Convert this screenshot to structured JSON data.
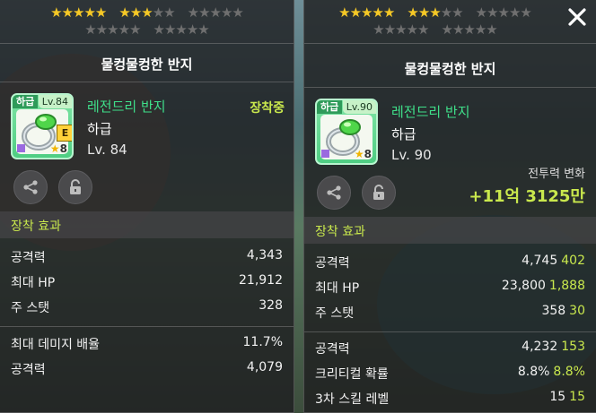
{
  "left_panel": {
    "stars_row1": {
      "filled_group1": 5,
      "total_group1": 5,
      "filled_group2": 3,
      "total_group2": 5,
      "filled_group3": 0,
      "total_group3": 5
    },
    "stars_row2": {
      "total_group1": 5,
      "total_group2": 5
    },
    "title": "물컹물컹한 반지",
    "item": {
      "grade_badge": "하급",
      "level_badge": "Lv.84",
      "name": "레전드리 반지",
      "grade": "하급",
      "level": "Lv. 84",
      "star_count": "8",
      "e_badge": "E"
    },
    "equipped_label": "장착중",
    "section_label": "장착 효과",
    "stats": [
      {
        "label": "공격력",
        "value": "4,343"
      },
      {
        "label": "최대 HP",
        "value": "21,912"
      },
      {
        "label": "주 스탯",
        "value": "328"
      }
    ],
    "stats2": [
      {
        "label": "최대 데미지 배율",
        "value": "11.7%"
      },
      {
        "label": "공격력",
        "value": "4,079"
      }
    ]
  },
  "right_panel": {
    "title": "물컹물컹한 반지",
    "item": {
      "grade_badge": "하급",
      "level_badge": "Lv.90",
      "name": "레전드리 반지",
      "grade": "하급",
      "level": "Lv. 90",
      "star_count": "8"
    },
    "battle_power_label": "전투력 변화",
    "battle_power_value": "+11억 3125만",
    "section_label": "장착 효과",
    "stats": [
      {
        "label": "공격력",
        "value": "4,745",
        "bonus": "402"
      },
      {
        "label": "최대 HP",
        "value": "23,800",
        "bonus": "1,888"
      },
      {
        "label": "주 스탯",
        "value": "358",
        "bonus": "30"
      }
    ],
    "stats2": [
      {
        "label": "공격력",
        "value": "4,232",
        "bonus": "153"
      },
      {
        "label": "크리티컬 확률",
        "value": "8.8%",
        "bonus": "8.8%"
      },
      {
        "label": "3차 스킬 레벨",
        "value": "15",
        "bonus": "15"
      }
    ]
  },
  "colors": {
    "accent_green": "#c9e84d",
    "name_green": "#3fe08a",
    "star_gold": "#f5c826"
  },
  "icons": [
    "share-icon",
    "lock-icon",
    "close-icon",
    "ring-icon"
  ]
}
